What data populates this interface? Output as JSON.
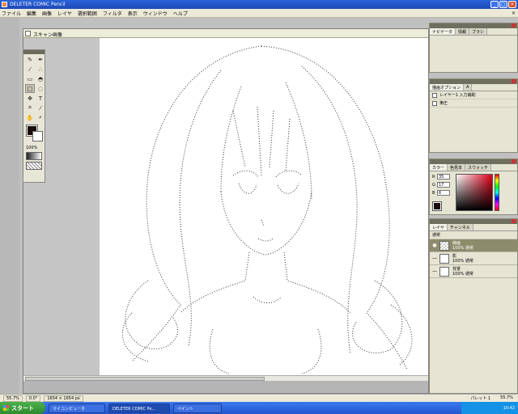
{
  "window": {
    "title": "DELETER COMIC Pencil",
    "minimize": "_",
    "maximize": "□",
    "close": "×"
  },
  "menu": {
    "items": [
      "ファイル",
      "編集",
      "画像",
      "レイヤ",
      "選択範囲",
      "フィルタ",
      "表示",
      "ウィンドウ",
      "ヘルプ"
    ],
    "right": "×"
  },
  "document": {
    "title": "スキャン画像"
  },
  "palette": {
    "zoom": "100%"
  },
  "panels": {
    "navigator": {
      "tabs": [
        "ナビゲータ",
        "情報",
        "ブラシ"
      ]
    },
    "tools": {
      "tabs": [
        "描画オプション",
        "A"
      ],
      "rows": [
        "レイヤー1 入力補助",
        "筆圧"
      ]
    },
    "color": {
      "tabs": [
        "カラー",
        "色見本",
        "スウォッチ"
      ],
      "values": [
        {
          "label": "R",
          "value": "35"
        },
        {
          "label": "G",
          "value": "17"
        },
        {
          "label": "B",
          "value": "6"
        }
      ]
    },
    "layers": {
      "tabs": [
        "レイヤ",
        "チャンネル"
      ],
      "mode": "通常",
      "rows": [
        {
          "name": "線画",
          "opacity": "100% 通常"
        },
        {
          "name": "影",
          "opacity": "100% 通常"
        },
        {
          "name": "背景",
          "opacity": "100% 通常"
        }
      ]
    }
  },
  "status": {
    "zoom": "55.7%",
    "angle": "0.0°",
    "size": "1654 × 1654 px",
    "right_a": "パレット 1",
    "right_b": "55.7%"
  },
  "taskbar": {
    "start": "スタート",
    "tasks": [
      "マイコンピュータ",
      "DELETER COMIC Pe...",
      "ペイント"
    ],
    "clock": "10:42"
  }
}
